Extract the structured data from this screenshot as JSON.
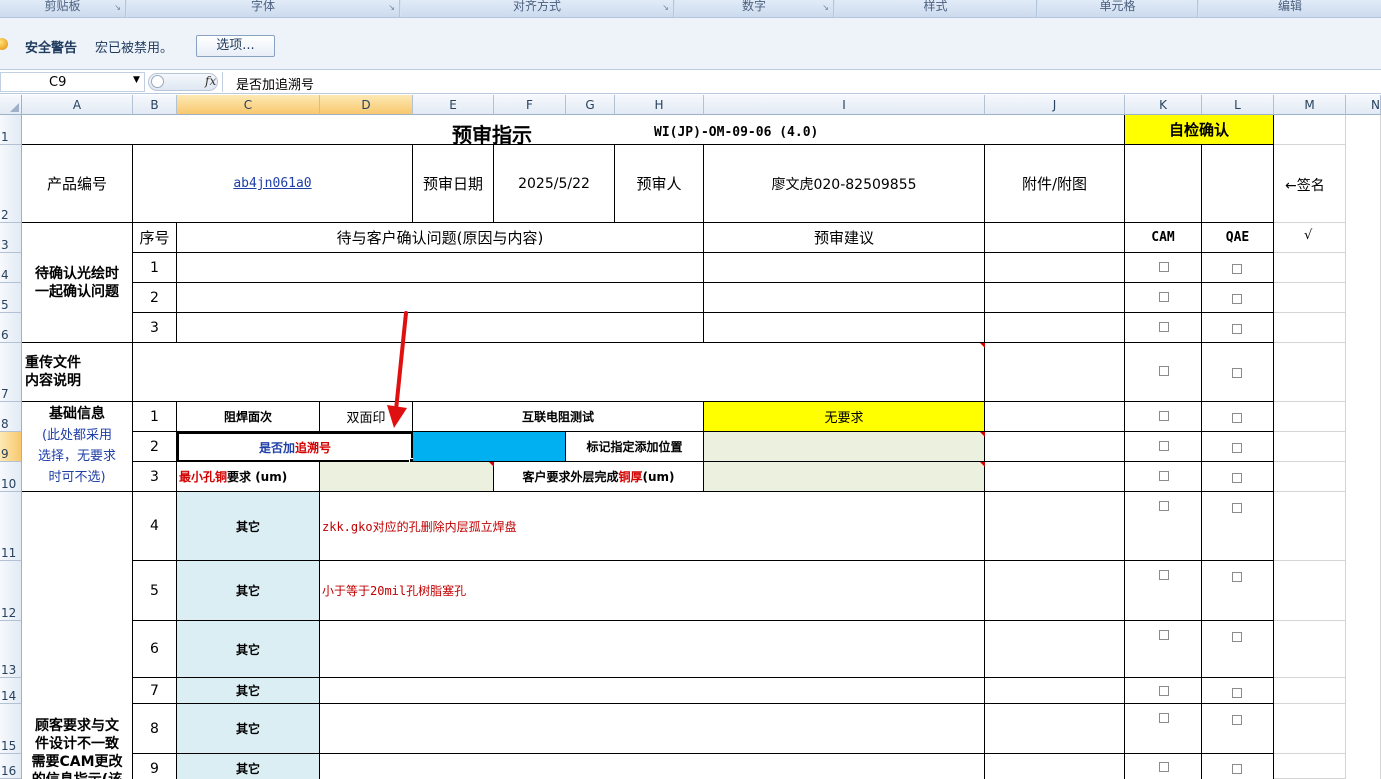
{
  "ribbon": {
    "groups": [
      "剪贴板",
      "字体",
      "对齐方式",
      "数字",
      "样式",
      "单元格",
      "编辑"
    ]
  },
  "security": {
    "title": "安全警告",
    "message": "宏已被禁用。",
    "options_button": "选项..."
  },
  "formula_bar": {
    "name_box": "C9",
    "fx": "fx",
    "content": "是否加追溯号"
  },
  "columns": [
    "A",
    "B",
    "C",
    "D",
    "E",
    "F",
    "G",
    "H",
    "I",
    "J",
    "K",
    "L",
    "M",
    "N"
  ],
  "rows": [
    "1",
    "2",
    "3",
    "4",
    "5",
    "6",
    "7",
    "8",
    "9",
    "10",
    "11",
    "12",
    "13",
    "14",
    "15",
    "16"
  ],
  "sheet": {
    "title": "预审指示",
    "doc_code": "WI(JP)-OM-09-06 (4.0)",
    "self_check": "自检确认",
    "product_no_label": "产品编号",
    "product_no_value": "ab4jn061a0",
    "review_date_label": "预审日期",
    "review_date_value": "2025/5/22",
    "reviewer_label": "预审人",
    "reviewer_value": "廖文虎020-82509855",
    "attachment_label": "附件/附图",
    "sign_note": "←签名",
    "seq_label": "序号",
    "question_header": "待与客户确认问题(原因与内容)",
    "suggestion_header": "预审建议",
    "cam_label": "CAM",
    "qae_label": "QAE",
    "checkmark": "√",
    "pending_label_1": "待确认光绘时",
    "pending_label_2": "一起确认问题",
    "pending_seq": [
      "1",
      "2",
      "3"
    ],
    "reupload_label_1": "重传文件",
    "reupload_label_2": "内容说明",
    "basic_label": "基础信息",
    "basic_note_1": "(此处都采用",
    "basic_note_2": "选择，无要求",
    "basic_note_3": "时可不选)",
    "basic_rows": {
      "r1_seq": "1",
      "solder_side_label": "阻焊面次",
      "solder_side_value": "双面印",
      "interconnect_label": "互联电阻测试",
      "interconnect_value": "无要求",
      "r2_seq": "2",
      "trace_no_part1": "是否加",
      "trace_no_part2": "追溯号",
      "mark_position_label": "标记指定添加位置",
      "r3_seq": "3",
      "min_hole_part1": "最小孔铜",
      "min_hole_part2": "要求 (um)",
      "outer_thick_part1": "客户要求外层完成",
      "outer_thick_part2": "铜厚",
      "outer_thick_part3": " (um)"
    },
    "customer_label_1": "顾客要求与文",
    "customer_label_2": "件设计不一致",
    "customer_label_3": "需要CAM更改",
    "customer_label_4": "的信息指示(该",
    "other_rows": [
      {
        "seq": "4",
        "type": "其它",
        "content": "zkk.gko对应的孔删除内层孤立焊盘"
      },
      {
        "seq": "5",
        "type": "其它",
        "content": "小于等于20mil孔树脂塞孔"
      },
      {
        "seq": "6",
        "type": "其它",
        "content": ""
      },
      {
        "seq": "7",
        "type": "其它",
        "content": ""
      },
      {
        "seq": "8",
        "type": "其它",
        "content": ""
      },
      {
        "seq": "9",
        "type": "其它",
        "content": ""
      }
    ]
  },
  "colors": {
    "yellow": "#ffff00",
    "blue_fill": "#00b0f0",
    "light_green": "#ebf1de",
    "light_blue": "#daeef3",
    "red_text": "#c00000",
    "link_blue": "#1f3fa8"
  }
}
